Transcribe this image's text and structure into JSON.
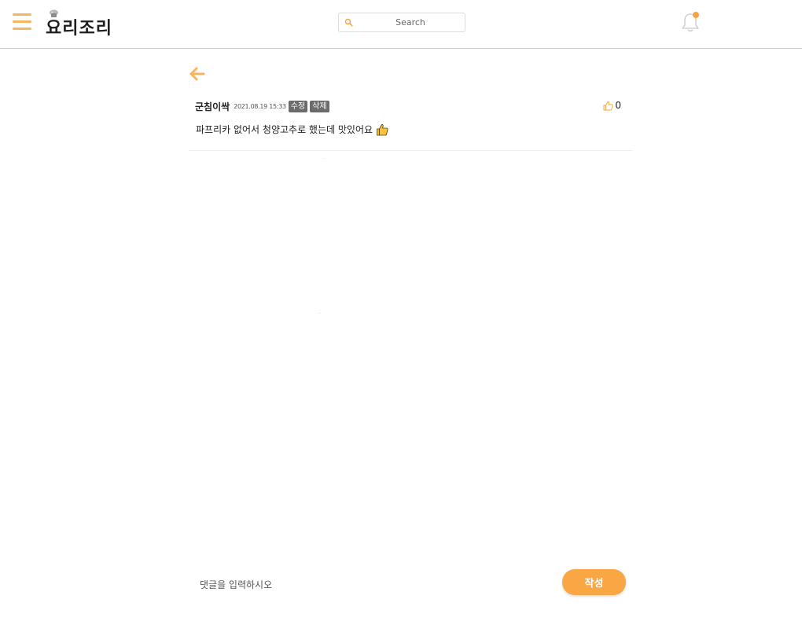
{
  "app": {
    "logo_text": "요리조리"
  },
  "header": {
    "search": {
      "placeholder": "Search"
    }
  },
  "comment": {
    "author": "군침이싹",
    "datetime": "2021.08.19 15:33",
    "edit_label": "수정",
    "delete_label": "삭제",
    "text": "파프리카 없어서 청양고추로 했는데 맛있어요",
    "likes": "0"
  },
  "reply": {
    "placeholder": "댓글을 입력하시오",
    "submit_label": "작성"
  },
  "colors": {
    "accent": "#f9a744",
    "header_border": "#f4c78e",
    "tag_bg": "#6b6b6b",
    "notification_dot": "#f7a23c"
  },
  "icons": {
    "menu": "hamburger-icon",
    "logo": "chef-hat-icon",
    "search": "search-icon",
    "notifications": "bell-icon",
    "back": "arrow-left-icon",
    "like": "thumbs-up-outline-icon",
    "emoji": "thumbs-up-emoji-icon"
  }
}
